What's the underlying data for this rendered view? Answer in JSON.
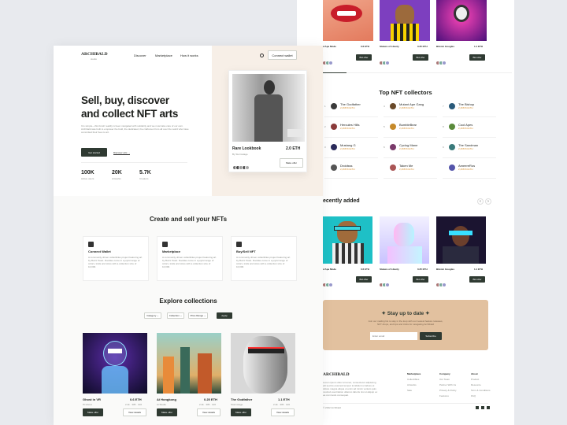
{
  "brand": {
    "name": "ARCHIBALD",
    "sub": "studio"
  },
  "nav": {
    "items": [
      "Discover",
      "Marketplace",
      "How it works"
    ],
    "cta": "Connect wallet"
  },
  "hero": {
    "title_l1": "Sell, buy, discover",
    "title_l2": "and collect NFT arts",
    "desc": "It is simple—this brush readily is been navigated with solidarity and we must take care of our own. Archibald was built to empower the bold, the dedicated, the craftsmen from all over the world who have committed their lives to art.",
    "primary": "Get started",
    "secondary": "Discover arts",
    "stats": [
      {
        "value": "100K",
        "label": "Active users"
      },
      {
        "value": "20K",
        "label": "Artworks"
      },
      {
        "value": "5.7K",
        "label": "Creators"
      }
    ]
  },
  "featured": {
    "title": "Rare Lookbook",
    "price": "2.0 ETH",
    "by": "By Stormstage",
    "btn": "Make offer"
  },
  "create": {
    "title": "Create and sell your NFTs",
    "items": [
      {
        "title": "Connect Wallet",
        "desc": "A community driven collectibles project featuring art by Burnt Toast. Doodles come in a joyful range of colors, traits and sizes with a collection size of 10,000."
      },
      {
        "title": "Marketplace",
        "desc": "A community driven collectibles project featuring art by Burnt Toast. Doodles come in a joyful range of colors, traits and sizes with a collection size of 10,000."
      },
      {
        "title": "Buy/Sell NFT",
        "desc": "A community driven collectibles project featuring art by Burnt Toast. Doodles come in a joyful range of colors, traits and sizes with a collection size of 10,000."
      }
    ]
  },
  "explore": {
    "title": "Explore collections",
    "filters": [
      "Category",
      "Collection",
      "Price Range"
    ],
    "apply": "Apply",
    "cards": [
      {
        "name": "Ghost in VR",
        "price": "0.6 ETH",
        "by": "Pt.Ghost",
        "meta": "2.4k · 305 · 120",
        "btn1": "Make offer",
        "btn2": "View details"
      },
      {
        "name": "Ai Hongkong",
        "price": "0.25 ETH",
        "by": "Ai.Studio",
        "meta": "2.4k · 305 · 120",
        "btn1": "Make offer",
        "btn2": "View details"
      },
      {
        "name": "The Godfather",
        "price": "1.1 ETH",
        "by": "Stormstage",
        "meta": "2.4k · 305 · 120",
        "btn1": "Make offer",
        "btn2": "View details"
      }
    ]
  },
  "back_top": {
    "cards": [
      {
        "name": "d Ape Mode",
        "price": "0.6 ETH",
        "by": "",
        "btn": "Bid offer"
      },
      {
        "name": "Stature of Liberty",
        "price": "0.25 ETH",
        "by": "Stormy ai",
        "btn": "Bid offer"
      },
      {
        "name": "Bitcoin Googles",
        "price": "1.1 ETH",
        "by": "Bitcoin",
        "btn": "Bid offer"
      }
    ]
  },
  "collectors": {
    "title": "Top NFT collectors",
    "list": [
      {
        "rank": "1",
        "name": "The Godfather",
        "val": "2,468.54 ETH"
      },
      {
        "rank": "4",
        "name": "Mutant Ape Gang",
        "val": "2,468.54 ETH"
      },
      {
        "rank": "7",
        "name": "The Bishop",
        "val": "2,468.54 ETH"
      },
      {
        "rank": "2",
        "name": "Hercules Hills",
        "val": "2,468.54 ETH"
      },
      {
        "rank": "5",
        "name": "BumbleBear",
        "val": "2,468.54 ETH"
      },
      {
        "rank": "8",
        "name": "Cool Apes",
        "val": "2,468.54 ETH"
      },
      {
        "rank": "3",
        "name": "Mustang G",
        "val": "2,468.54 ETH"
      },
      {
        "rank": "6",
        "name": "Cyclog Mane",
        "val": "2,468.54 ETH"
      },
      {
        "rank": "9",
        "name": "The Sandman",
        "val": "2,468.54 ETH"
      },
      {
        "rank": "",
        "name": "Droidsss",
        "val": "2,468.54 ETH"
      },
      {
        "rank": "",
        "name": "Taken Me",
        "val": "2,468.54 ETH"
      },
      {
        "rank": "",
        "name": "AmeereRus",
        "val": "2,468.54 ETH"
      }
    ]
  },
  "recent": {
    "title": "ecently added",
    "cards": [
      {
        "name": "d Ape Mode",
        "price": "0.6 ETH",
        "btn": "Bid offer"
      },
      {
        "name": "Stature of Liberty",
        "price": "0.25 ETH",
        "btn": "Bid offer"
      },
      {
        "name": "Bitcoin Googles",
        "price": "1.1 ETH",
        "btn": "Bid offer"
      }
    ]
  },
  "newsletter": {
    "title": "Stay up to date",
    "desc": "Join our mailing list to stay in the loop with our newest feature releases, NFT drops, and tips and tricks for navigating Archibald",
    "placeholder": "Enter email",
    "btn": "Subscribe"
  },
  "footer": {
    "brand": "ARCHIBALD",
    "desc": "Lorem ipsum dolor sit amet, consectetur adipiscing elit sed do eiusmod tempor incididunt ut labore et dolore magna aliqua ut enim ad minim veniam quis nostrud exercitation ullamco laboris nisi ut aliquip ex ea commodo consequat.",
    "copy": "© 2022 Archibald",
    "cols": [
      {
        "title": "Marketplace",
        "items": [
          "Collectibles",
          "Artworks",
          "Sale"
        ]
      },
      {
        "title": "Company",
        "items": [
          "Our Team",
          "Partner With Us",
          "Privacy & Policy",
          "Features"
        ]
      },
      {
        "title": "About",
        "items": [
          "Product",
          "Resource",
          "Term & Conditions",
          "FAQ"
        ]
      }
    ]
  }
}
